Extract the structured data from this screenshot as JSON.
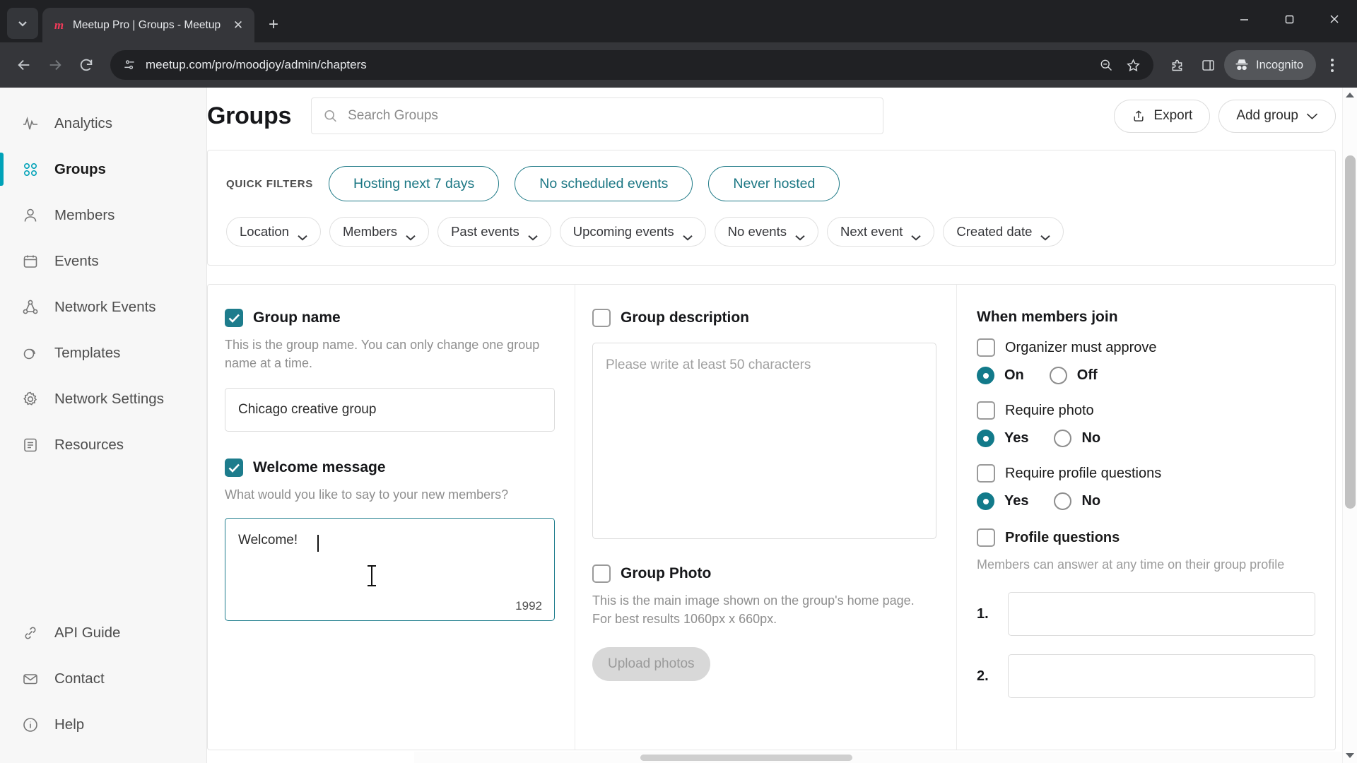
{
  "browser": {
    "tab": {
      "title": "Meetup Pro | Groups - Meetup",
      "favicon_letter": "m"
    },
    "new_tab_label": "+",
    "close_label": "✕",
    "url": "meetup.com/pro/moodjoy/admin/chapters",
    "profile_label": "Incognito"
  },
  "sidebar": {
    "items": [
      {
        "label": "Analytics",
        "icon": "analytics-icon",
        "active": false
      },
      {
        "label": "Groups",
        "icon": "groups-icon",
        "active": true
      },
      {
        "label": "Members",
        "icon": "members-icon",
        "active": false
      },
      {
        "label": "Events",
        "icon": "calendar-icon",
        "active": false
      },
      {
        "label": "Network Events",
        "icon": "network-events-icon",
        "active": false
      },
      {
        "label": "Templates",
        "icon": "templates-icon",
        "active": false
      },
      {
        "label": "Network Settings",
        "icon": "gear-icon",
        "active": false
      },
      {
        "label": "Resources",
        "icon": "resources-icon",
        "active": false
      }
    ],
    "bottom_items": [
      {
        "label": "API Guide",
        "icon": "link-icon"
      },
      {
        "label": "Contact",
        "icon": "mail-icon"
      },
      {
        "label": "Help",
        "icon": "info-icon"
      }
    ]
  },
  "header": {
    "title": "Groups",
    "search_placeholder": "Search Groups",
    "search_value": "",
    "export_label": "Export",
    "add_group_label": "Add group"
  },
  "filters": {
    "quick_filters_label": "QUICK FILTERS",
    "quick_pills": [
      "Hosting next 7 days",
      "No scheduled events",
      "Never hosted"
    ],
    "dropdowns": [
      "Location",
      "Members",
      "Past events",
      "Upcoming events",
      "No events",
      "Next event",
      "Created date"
    ]
  },
  "form": {
    "group_name": {
      "title": "Group name",
      "checked": true,
      "description": "This is the group name. You can only change one group name at a time.",
      "value": "Chicago creative group"
    },
    "welcome_message": {
      "title": "Welcome message",
      "checked": true,
      "description": "What would you like to say to your new members?",
      "value": "Welcome!",
      "char_count": "1992"
    },
    "group_description": {
      "title": "Group description",
      "checked": false,
      "placeholder": "Please write at least 50 characters",
      "value": ""
    },
    "group_photo": {
      "title": "Group Photo",
      "checked": false,
      "description": "This is the main image shown on the group's home page. For best results 1060px x 660px.",
      "upload_label": "Upload photos"
    },
    "when_members_join": {
      "title": "When members join",
      "organizer_approve": {
        "label": "Organizer must approve",
        "checked": false,
        "options": [
          "On",
          "Off"
        ],
        "selected": "On"
      },
      "require_photo": {
        "label": "Require photo",
        "checked": false,
        "options": [
          "Yes",
          "No"
        ],
        "selected": "Yes"
      },
      "require_profile_questions": {
        "label": "Require profile questions",
        "checked": false,
        "options": [
          "Yes",
          "No"
        ],
        "selected": "Yes"
      },
      "profile_questions": {
        "label": "Profile questions",
        "checked": false,
        "description": "Members can answer at any time on their group profile",
        "items": [
          {
            "num": "1.",
            "value": ""
          },
          {
            "num": "2.",
            "value": ""
          }
        ]
      }
    }
  },
  "colors": {
    "accent_teal": "#1d7c8c",
    "sidebar_active": "#00a2b8",
    "pill_border": "#1f7a87",
    "chrome_dark": "#35363a"
  }
}
